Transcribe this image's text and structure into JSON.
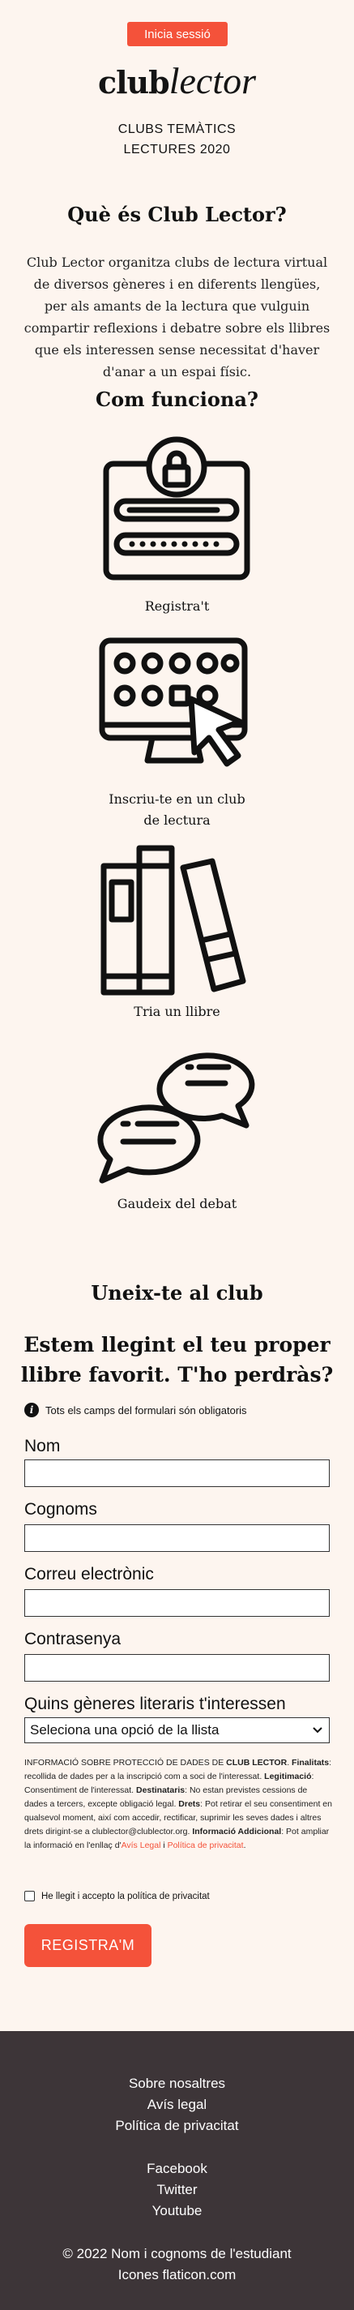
{
  "header": {
    "login_label": "Inicia sessió",
    "logo": {
      "part1": "club",
      "part2": "lector"
    },
    "subtitle_line1": "CLUBS TEMÀTICS",
    "subtitle_line2": "LECTURES 2020"
  },
  "about": {
    "title": "Què és Club Lector?",
    "text": "Club Lector organitza clubs de lectura virtual de diversos gèneres i en diferents llengües, per als amants de la lectura que vulguin compartir reflexions i debatre sobre els llibres que els interessen sense necessitat d'haver d'anar a un espai físic."
  },
  "how": {
    "title": "Com funciona?",
    "steps": [
      {
        "label": "Registra't",
        "icon": "registration-form-icon"
      },
      {
        "label_line1": "Inscriu-te en un club",
        "label_line2": "de lectura",
        "icon": "select-club-icon"
      },
      {
        "label": "Tria un llibre",
        "icon": "books-icon"
      },
      {
        "label": "Gaudeix del debat",
        "icon": "chat-bubbles-icon"
      }
    ]
  },
  "join": {
    "title": "Uneix-te al club",
    "subtitle_line1": "Estem llegint el teu proper",
    "subtitle_line2": "llibre favorit. T'ho perdràs?",
    "required_note": "Tots els camps del formulari són obligatoris",
    "fields": {
      "name_label": "Nom",
      "surname_label": "Cognoms",
      "email_label": "Correu electrònic",
      "password_label": "Contrasenya",
      "genres_label": "Quins gèneres literaris t'interessen",
      "genres_selected": "Seleciona una opció de la llista"
    },
    "legal": {
      "heading": "INFORMACIÓ SOBRE PROTECCIÓ DE DADES DE",
      "brand": "CLUB LECTOR",
      "finalitats_label": "Finalitats",
      "finalitats_text": ": recollida de dades per a la inscripció com a soci de l'interessat.",
      "legitimacio_label": "Legitimació",
      "legitimacio_text": ": Consentiment de l'interessat.",
      "destinataris_label": "Destinataris",
      "destinataris_text": ": No estan previstes cessions de dades a tercers, excepte obligació legal.",
      "drets_label": "Drets",
      "drets_text": ": Pot retirar el seu consentiment en qualsevol moment, així com accedir, rectificar, suprimir les seves dades i altres drets dirigint-se a clublector@clublector.org.",
      "info_label": "Informació Addicional",
      "info_text": ": Pot ampliar la informació en l'enllaç d'",
      "link1": "Avís Legal",
      "and": " i ",
      "link2": "Política de privacitat",
      "end": "."
    },
    "accept_label": "He llegit i accepto la política de privacitat",
    "submit_label": "REGISTRA'M"
  },
  "footer": {
    "links": [
      "Sobre nosaltres",
      "Avís legal",
      "Política de privacitat"
    ],
    "social": [
      "Facebook",
      "Twitter",
      "Youtube"
    ],
    "copyright": "© 2022 Nom i cognoms de l'estudiant",
    "credits": "Icones flaticon.com"
  },
  "colors": {
    "accent": "#f4523a",
    "background": "#fdf5ef",
    "footer": "#3d3538"
  }
}
